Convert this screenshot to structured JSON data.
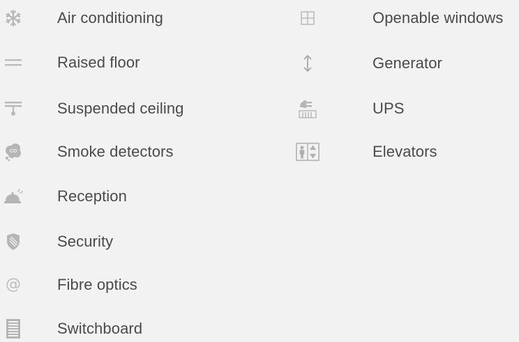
{
  "amenities_left": [
    {
      "icon": "snowflake-icon",
      "label": "Air conditioning"
    },
    {
      "icon": "raised-floor-icon",
      "label": "Raised floor"
    },
    {
      "icon": "suspended-ceiling-icon",
      "label": "Suspended ceiling"
    },
    {
      "icon": "smoke-detector-icon",
      "label": "Smoke detectors"
    },
    {
      "icon": "reception-bell-icon",
      "label": "Reception"
    },
    {
      "icon": "shield-icon",
      "label": "Security"
    },
    {
      "icon": "at-sign-icon",
      "label": "Fibre optics"
    },
    {
      "icon": "switchboard-icon",
      "label": "Switchboard"
    }
  ],
  "amenities_right": [
    {
      "icon": "window-icon",
      "label": "Openable windows"
    },
    {
      "icon": "vertical-arrows-icon",
      "label": "Generator"
    },
    {
      "icon": "ups-plug-icon",
      "label": "UPS"
    },
    {
      "icon": "elevator-icon",
      "label": "Elevators"
    }
  ],
  "colors": {
    "background": "#f2f2f2",
    "text": "#4a4a4a",
    "icon": "#b5b5b5"
  }
}
